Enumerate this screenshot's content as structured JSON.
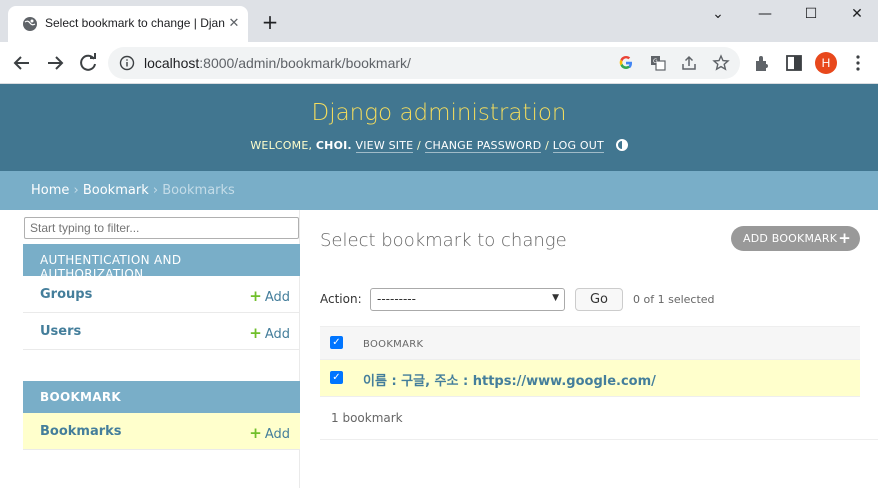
{
  "browser": {
    "tab_title": "Select bookmark to change | Django site admin",
    "url_host": "localhost",
    "url_rest": ":8000/admin/bookmark/bookmark/",
    "profile_initial": "H"
  },
  "header": {
    "brand": "Django administration",
    "welcome": "WELCOME,",
    "username": "CHOI",
    "view_site": "VIEW SITE",
    "change_password": "CHANGE PASSWORD",
    "log_out": "LOG OUT"
  },
  "breadcrumbs": {
    "home": "Home",
    "app": "Bookmark",
    "current": "Bookmarks"
  },
  "sidebar": {
    "filter_placeholder": "Start typing to filter...",
    "apps": [
      {
        "caption": "AUTHENTICATION AND AUTHORIZATION",
        "models": [
          {
            "name": "Groups",
            "add": "Add"
          },
          {
            "name": "Users",
            "add": "Add"
          }
        ]
      },
      {
        "caption": "BOOKMARK",
        "models": [
          {
            "name": "Bookmarks",
            "add": "Add"
          }
        ]
      }
    ]
  },
  "main": {
    "title": "Select bookmark to change",
    "add_button": "ADD BOOKMARK",
    "action_label": "Action:",
    "action_value": "---------",
    "go_label": "Go",
    "selected_count": "0 of 1 selected",
    "column_header": "BOOKMARK",
    "rows": [
      {
        "text": "이름 : 구글, 주소 : https://www.google.com/"
      }
    ],
    "result_count": "1 bookmark"
  },
  "colors": {
    "header_bg": "#417690",
    "brand": "#f5dd5d",
    "breadcrumb_bg": "#79aec8",
    "link": "#447e9b",
    "selected_row": "#ffffcc",
    "add_plus": "#70bf2b"
  }
}
